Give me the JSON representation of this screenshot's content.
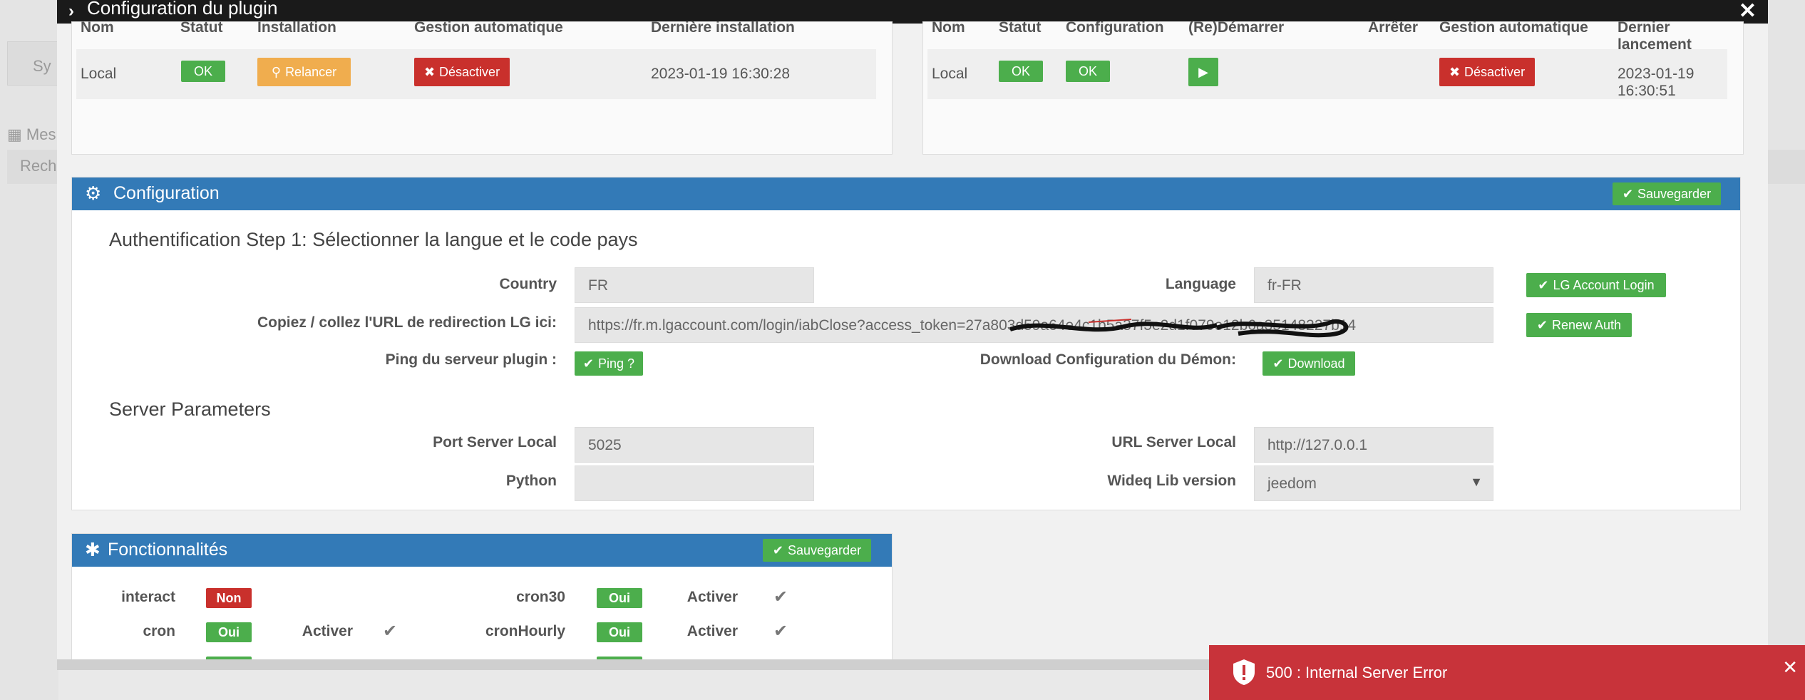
{
  "modal": {
    "title": "Configuration du plugin"
  },
  "background": {
    "frag_sy": "Sy",
    "frag_mes": "Mes",
    "frag_rech": "Rech"
  },
  "install": {
    "headers": [
      "Nom",
      "Statut",
      "Installation",
      "Gestion automatique",
      "Dernière installation"
    ],
    "row": {
      "nom": "Local",
      "statut": "OK",
      "installation": "Relancer",
      "gestion": "Désactiver",
      "date": "2023-01-19 16:30:28"
    }
  },
  "daemon": {
    "headers": [
      "Nom",
      "Statut",
      "Configuration",
      "(Re)Démarrer",
      "Arrêter",
      "Gestion automatique",
      "Dernier lancement"
    ],
    "row": {
      "nom": "Local",
      "statut": "OK",
      "configuration": "OK",
      "gestion": "Désactiver",
      "date": "2023-01-19 16:30:51"
    }
  },
  "config": {
    "title": "Configuration",
    "save": "Sauvegarder",
    "step1": "Authentification Step 1: Sélectionner la langue et le code pays",
    "country_label": "Country",
    "country_value": "FR",
    "language_label": "Language",
    "language_value": "fr-FR",
    "lg_login": "LG Account Login",
    "url_label": "Copiez / collez l'URL de redirection LG ici:",
    "url_value": "https://fr.m.lgaccount.com/login/iabClose?access_token=27a803d59a64e4c1b5a37f5e2d1f079e12b6a35148227b14",
    "renew": "Renew Auth",
    "ping_label": "Ping du serveur plugin :",
    "ping": "Ping ?",
    "download_label": "Download Configuration du Démon:",
    "download": "Download",
    "server_title": "Server Parameters",
    "port_label": "Port Server Local",
    "port_value": "5025",
    "url_server_label": "URL Server Local",
    "url_server_value": "http://127.0.0.1",
    "python_label": "Python",
    "python_value": "",
    "wideq_label": "Wideq Lib version",
    "wideq_value": "jeedom"
  },
  "features": {
    "title": "Fonctionnalités",
    "save": "Sauvegarder",
    "rows": [
      {
        "name": "interact",
        "state": "Non",
        "activer": ""
      },
      {
        "name": "cron",
        "state": "Oui",
        "activer": "Activer"
      },
      {
        "name": "cron30",
        "state": "Oui",
        "activer": "Activer"
      },
      {
        "name": "cronHourly",
        "state": "Oui",
        "activer": "Activer"
      }
    ]
  },
  "error": {
    "message": "500 : Internal Server Error"
  },
  "colors": {
    "primary": "#337ab7",
    "success": "#4cae4c",
    "danger": "#c9302c",
    "warning": "#f0ad4e",
    "error_toast": "#c8333a"
  }
}
